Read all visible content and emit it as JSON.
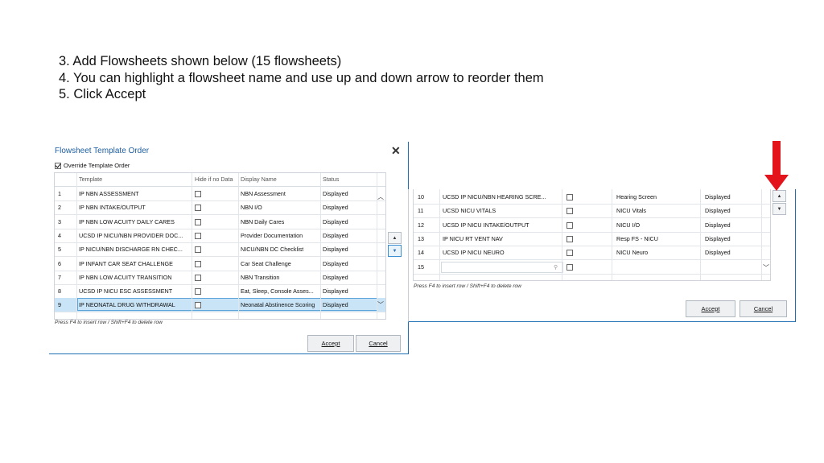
{
  "instructions": {
    "line1": "3. Add Flowsheets shown below (15 flowsheets)",
    "line2": "4. You can highlight a flowsheet name and use up and down arrow to reorder them",
    "line3": "5. Click Accept"
  },
  "left_dialog": {
    "title": "Flowsheet Template Order",
    "close_glyph": "✕",
    "override_label": "Override Template Order",
    "override_checked": true,
    "columns": [
      "",
      "Template",
      "Hide if no Data",
      "Display Name",
      "Status"
    ],
    "rows": [
      {
        "num": "1",
        "template": "IP NBN ASSESSMENT",
        "display": "NBN Assessment",
        "status": "Displayed"
      },
      {
        "num": "2",
        "template": "IP NBN INTAKE/OUTPUT",
        "display": "NBN I/O",
        "status": "Displayed"
      },
      {
        "num": "3",
        "template": "IP NBN LOW ACUITY DAILY CARES",
        "display": "NBN Daily Cares",
        "status": "Displayed"
      },
      {
        "num": "4",
        "template": "UCSD IP NICU/NBN PROVIDER DOC...",
        "display": "Provider Documentation",
        "status": "Displayed"
      },
      {
        "num": "5",
        "template": "IP NICU/NBN DISCHARGE RN CHEC...",
        "display": "NICU/NBN DC Checklist",
        "status": "Displayed"
      },
      {
        "num": "6",
        "template": "IP INFANT CAR SEAT CHALLENGE",
        "display": "Car Seat Challenge",
        "status": "Displayed"
      },
      {
        "num": "7",
        "template": "IP NBN LOW ACUITY TRANSITION",
        "display": "NBN Transition",
        "status": "Displayed"
      },
      {
        "num": "8",
        "template": "UCSD IP NICU ESC ASSESSMENT",
        "display": "Eat, Sleep, Console Asses...",
        "status": "Displayed"
      },
      {
        "num": "9",
        "template": "IP NEONATAL DRUG WITHDRAWAL",
        "display": "Neonatal Abstinence Scoring",
        "status": "Displayed",
        "selected": true
      }
    ],
    "hint": "Press F4 to insert row / Shift+F4 to delete row",
    "accept_label": "Accept",
    "cancel_label": "Cancel",
    "accept_key": "A",
    "cancel_key": "C",
    "up_glyph": "▲",
    "down_glyph": "▼",
    "scroll_up_glyph": "⌃",
    "scroll_down_glyph": "⌄"
  },
  "right_dialog": {
    "rows": [
      {
        "num": "10",
        "template": "UCSD IP NICU/NBN HEARING SCRE...",
        "display": "Hearing Screen",
        "status": "Displayed"
      },
      {
        "num": "11",
        "template": "UCSD NICU VITALS",
        "display": "NICU Vitals",
        "status": "Displayed"
      },
      {
        "num": "12",
        "template": "UCSD IP NICU INTAKE/OUTPUT",
        "display": "NICU I/O",
        "status": "Displayed"
      },
      {
        "num": "13",
        "template": "IP NICU RT VENT NAV",
        "display": "Resp FS - NICU",
        "status": "Displayed"
      },
      {
        "num": "14",
        "template": "UCSD IP NICU NEURO",
        "display": "NICU Neuro",
        "status": "Displayed"
      },
      {
        "num": "15",
        "template": "",
        "display": "",
        "status": ""
      }
    ],
    "hint": "Press F4 to insert row / Shift+F4 to delete row",
    "accept_label": "Accept",
    "cancel_label": "Cancel",
    "search_glyph": "⚲"
  },
  "colors": {
    "accent": "#1f6fb5",
    "selected_row": "#c9e4f6",
    "arrow_red": "#e3141b"
  }
}
